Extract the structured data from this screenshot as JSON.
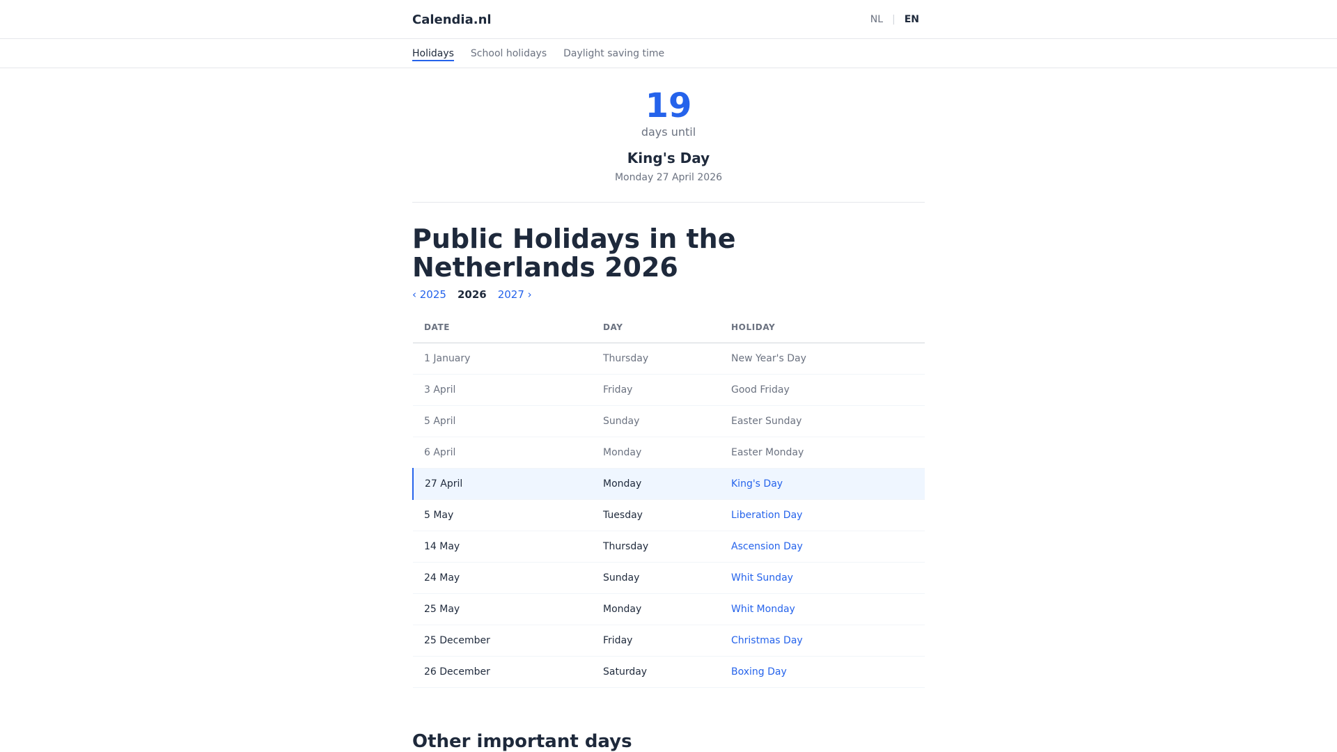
{
  "header": {
    "logo": "Calendia.nl",
    "lang_nl": "NL",
    "lang_sep": "|",
    "lang_en": "EN"
  },
  "subnav": {
    "items": [
      {
        "label": "Holidays",
        "active": true
      },
      {
        "label": "School holidays",
        "active": false
      },
      {
        "label": "Daylight saving time",
        "active": false
      }
    ]
  },
  "countdown": {
    "number": "19",
    "label": "days until",
    "holiday": "King's Day",
    "date": "Monday 27 April 2026"
  },
  "main": {
    "title": "Public Holidays in the Netherlands 2026",
    "year_nav": {
      "prev": "‹ 2025",
      "current": "2026",
      "next": "2027 ›"
    },
    "table": {
      "headers": [
        "DATE",
        "DAY",
        "HOLIDAY"
      ],
      "rows": [
        {
          "date": "1 January",
          "day": "Thursday",
          "holiday": "New Year's Day",
          "status": "past"
        },
        {
          "date": "3 April",
          "day": "Friday",
          "holiday": "Good Friday",
          "status": "past"
        },
        {
          "date": "5 April",
          "day": "Sunday",
          "holiday": "Easter Sunday",
          "status": "past"
        },
        {
          "date": "6 April",
          "day": "Monday",
          "holiday": "Easter Monday",
          "status": "past"
        },
        {
          "date": "27 April",
          "day": "Monday",
          "holiday": "King's Day",
          "status": "next"
        },
        {
          "date": "5 May",
          "day": "Tuesday",
          "holiday": "Liberation Day",
          "status": "future"
        },
        {
          "date": "14 May",
          "day": "Thursday",
          "holiday": "Ascension Day",
          "status": "future"
        },
        {
          "date": "24 May",
          "day": "Sunday",
          "holiday": "Whit Sunday",
          "status": "future"
        },
        {
          "date": "25 May",
          "day": "Monday",
          "holiday": "Whit Monday",
          "status": "future"
        },
        {
          "date": "25 December",
          "day": "Friday",
          "holiday": "Christmas Day",
          "status": "future"
        },
        {
          "date": "26 December",
          "day": "Saturday",
          "holiday": "Boxing Day",
          "status": "future"
        }
      ]
    },
    "other_title": "Other important days"
  },
  "colors": {
    "accent": "#2563eb",
    "text": "#1e293b",
    "muted": "#6b7280",
    "highlight_bg": "#eff6ff"
  }
}
